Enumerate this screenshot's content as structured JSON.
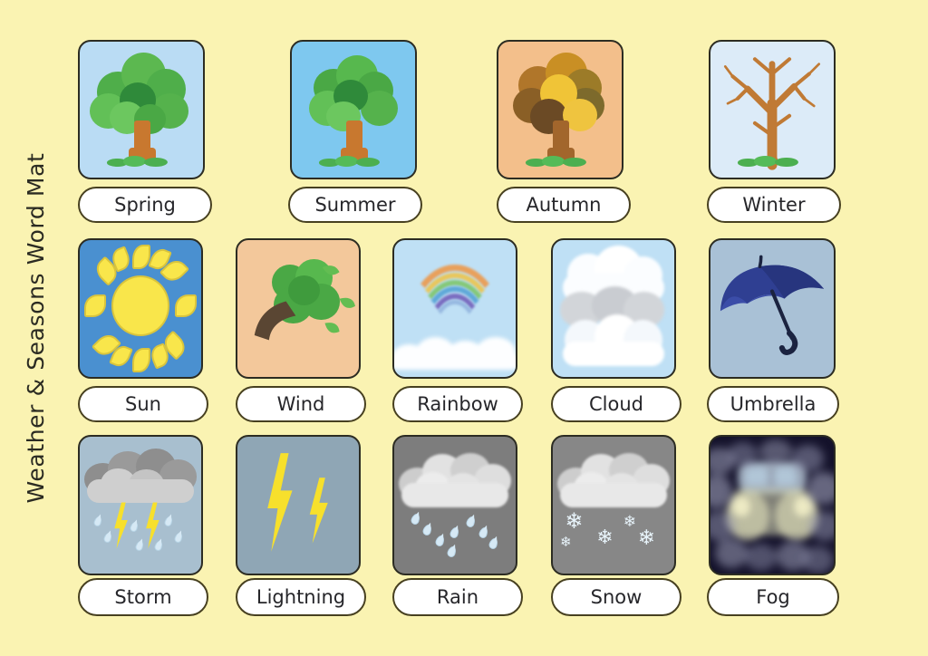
{
  "page": {
    "title": "Weather & Seasons Word Mat",
    "background_color": "#faf3b2",
    "label_border_color": "#474020",
    "card_border_color": "#2c2c22"
  },
  "grid": {
    "rows": [
      {
        "row_name": "seasons",
        "cards": [
          {
            "label": "Spring",
            "icon": "tree-spring-icon",
            "scene": "tree-green",
            "bg": "#badcf4"
          },
          {
            "label": "Summer",
            "icon": "tree-summer-icon",
            "scene": "tree-green",
            "bg": "#7ec8ef"
          },
          {
            "label": "Autumn",
            "icon": "tree-autumn-icon",
            "scene": "tree-autumn",
            "bg": "#f3bf8b"
          },
          {
            "label": "Winter",
            "icon": "tree-winter-icon",
            "scene": "tree-bare",
            "bg": "#dcebf8"
          }
        ]
      },
      {
        "row_name": "weather-mild",
        "cards": [
          {
            "label": "Sun",
            "icon": "sun-icon",
            "scene": "sun",
            "bg": "#4a90d0"
          },
          {
            "label": "Wind",
            "icon": "wind-icon",
            "scene": "wind",
            "bg": "#f3c89b"
          },
          {
            "label": "Rainbow",
            "icon": "rainbow-icon",
            "scene": "rainbow",
            "bg": "#bfe0f5"
          },
          {
            "label": "Cloud",
            "icon": "cloud-icon",
            "scene": "cloud",
            "bg": "#bfe0f5"
          },
          {
            "label": "Umbrella",
            "icon": "umbrella-icon",
            "scene": "umbrella",
            "bg": "#a9c1d6"
          }
        ]
      },
      {
        "row_name": "weather-severe",
        "cards": [
          {
            "label": "Storm",
            "icon": "storm-icon",
            "scene": "storm",
            "bg": "#a8bfcf"
          },
          {
            "label": "Lightning",
            "icon": "lightning-icon",
            "scene": "lightning",
            "bg": "#8fa6b5"
          },
          {
            "label": "Rain",
            "icon": "rain-icon",
            "scene": "rain",
            "bg": "#7d7d7d"
          },
          {
            "label": "Snow",
            "icon": "snow-icon",
            "scene": "snow",
            "bg": "#878787"
          },
          {
            "label": "Fog",
            "icon": "fog-icon",
            "scene": "fog",
            "bg": "#14122b"
          }
        ]
      }
    ]
  }
}
